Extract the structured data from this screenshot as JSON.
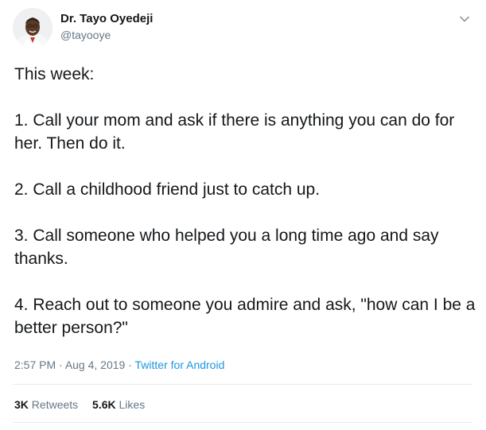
{
  "author": {
    "display_name": "Dr. Tayo Oyedeji",
    "handle": "@tayooye"
  },
  "tweet": {
    "paragraphs": [
      "This week:",
      "1. Call your mom and ask if there is anything you can do for her. Then do it.",
      "2. Call a childhood friend just to catch up.",
      "3. Call someone who helped you a long time ago and say thanks.",
      "4. Reach out to someone you admire and ask, \"how can I be a better person?\""
    ],
    "time": "2:57 PM",
    "date": "Aug 4, 2019",
    "source": "Twitter for Android",
    "separator": " · "
  },
  "stats": {
    "retweets_count": "3K",
    "retweets_label": "Retweets",
    "likes_count": "5.6K",
    "likes_label": "Likes"
  },
  "icons": {
    "caret": "chevron-down-icon",
    "avatar": "avatar"
  },
  "colors": {
    "text": "#14171a",
    "secondary": "#657786",
    "link": "#1b95e0",
    "divider": "#e6ecf0"
  }
}
